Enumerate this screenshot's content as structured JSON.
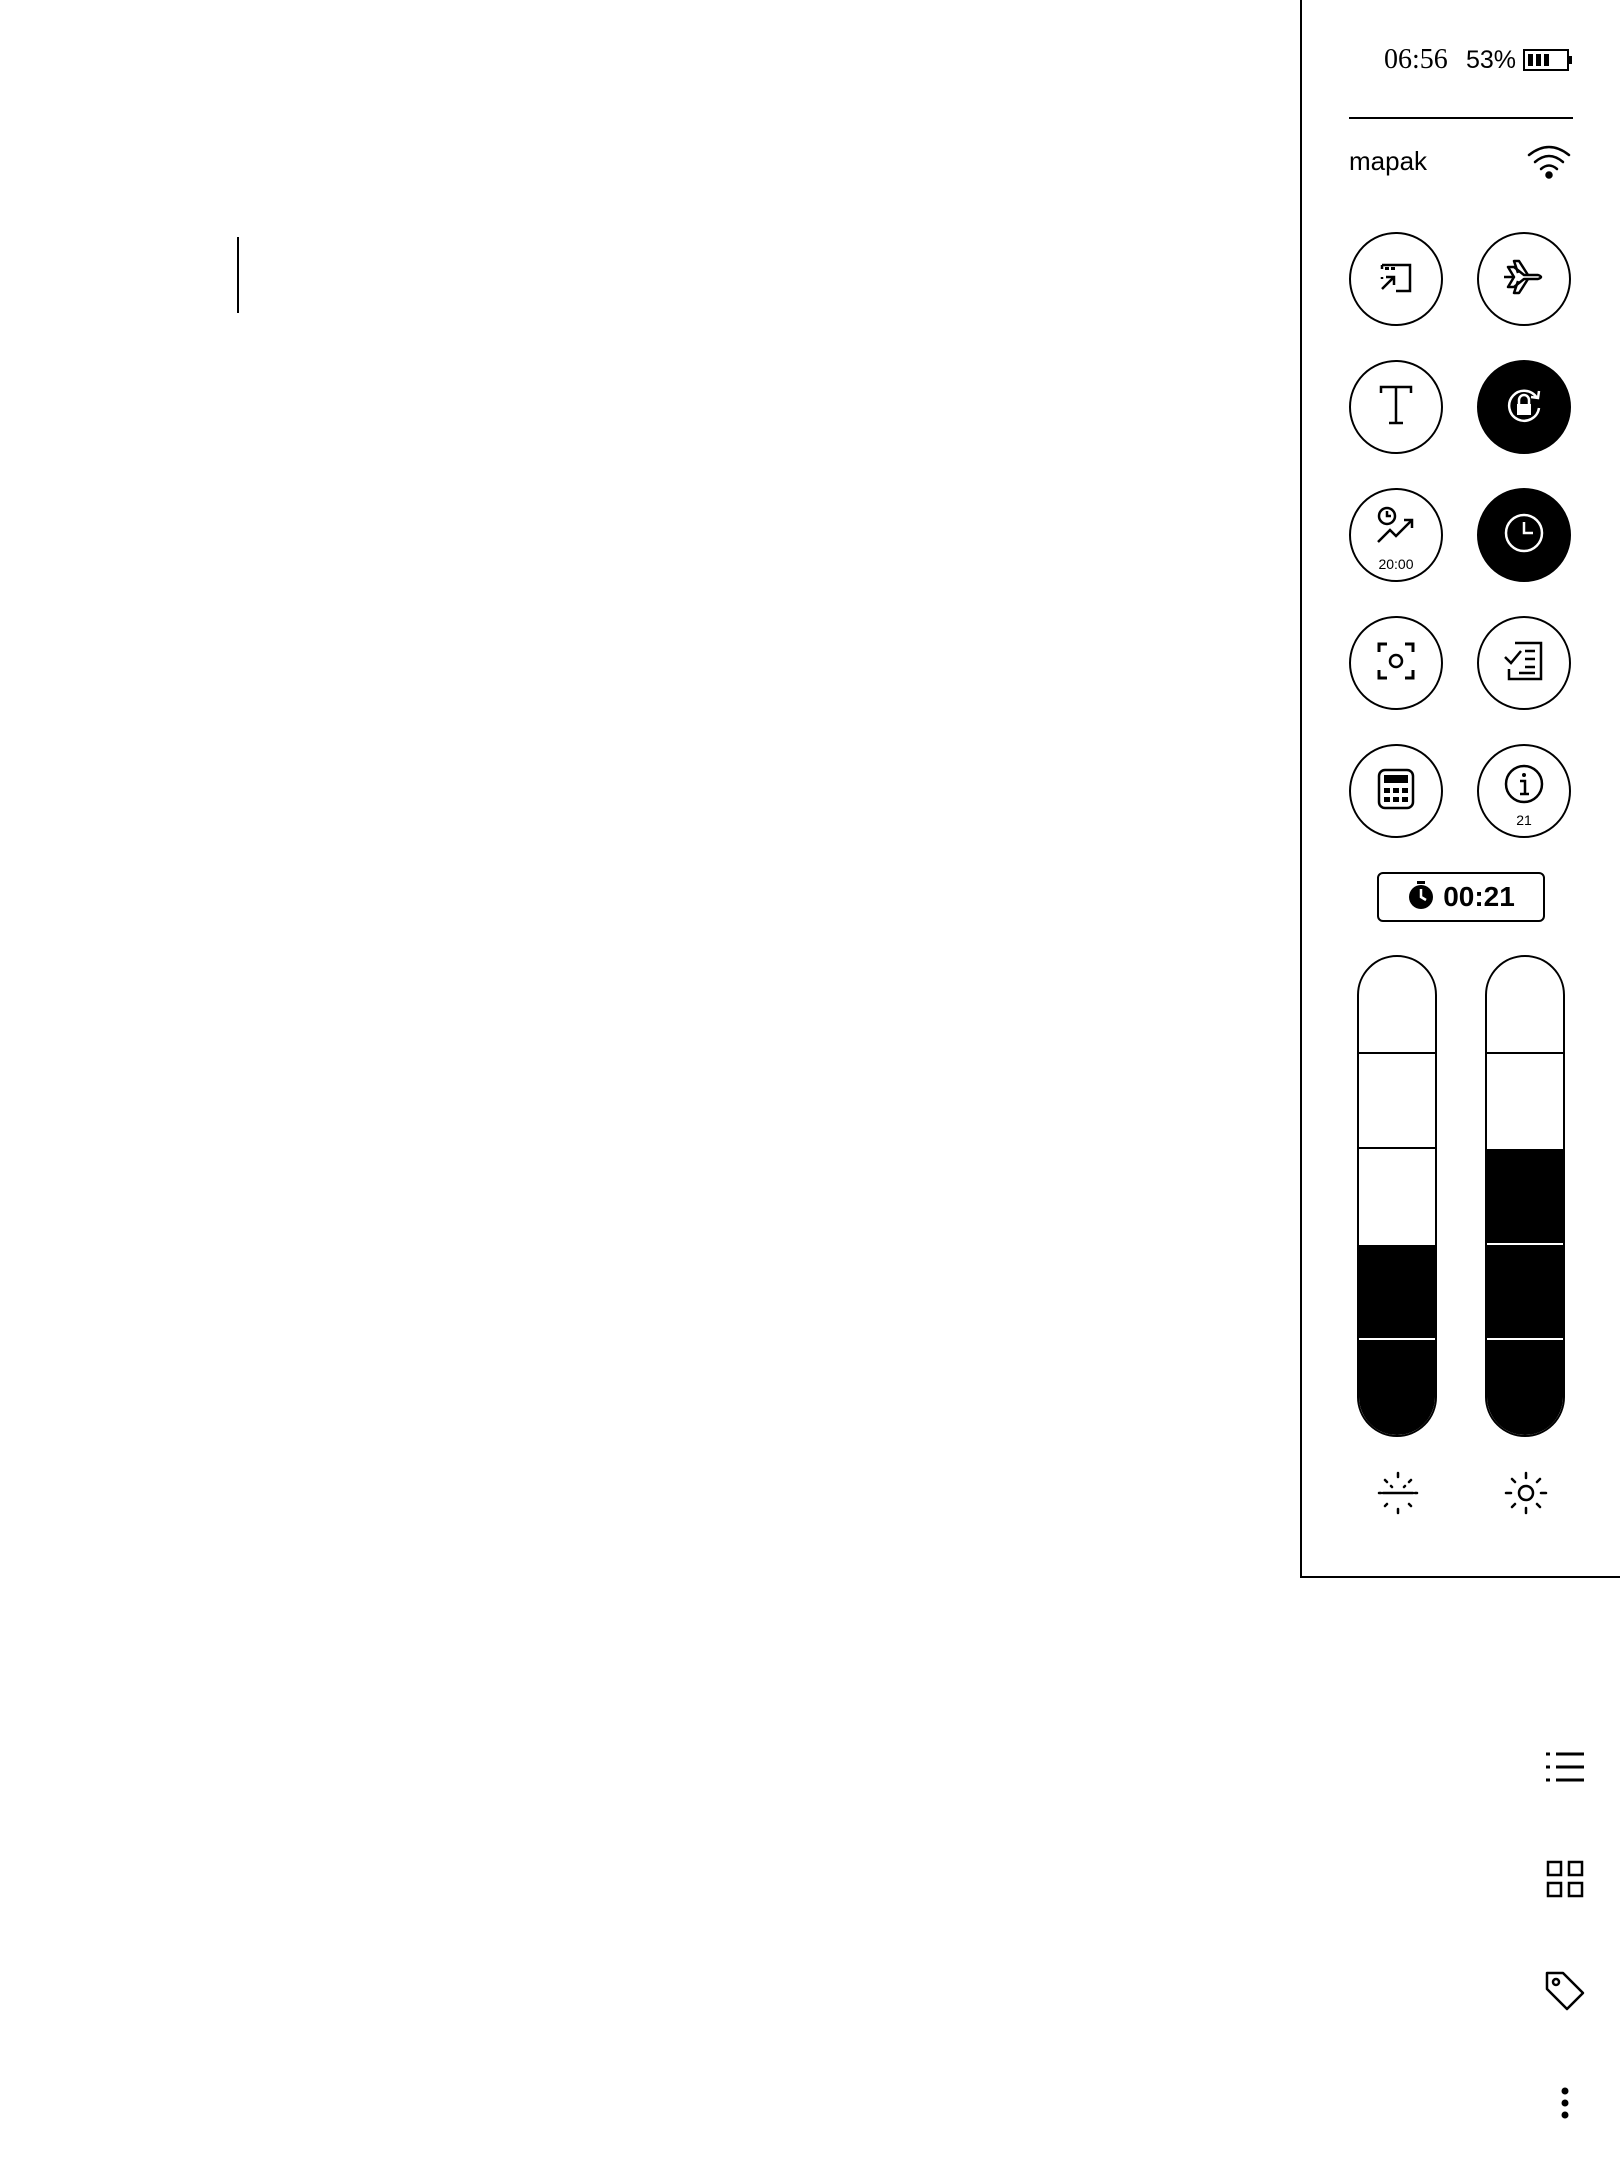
{
  "status": {
    "time": "06:56",
    "battery_percent": "53%"
  },
  "wifi": {
    "network_name": "mapak"
  },
  "quick_settings": [
    {
      "name": "screencast",
      "icon": "cast-icon",
      "active": false
    },
    {
      "name": "airplane-mode",
      "icon": "airplane-icon",
      "active": false
    },
    {
      "name": "font",
      "icon": "text-icon",
      "active": false
    },
    {
      "name": "rotation-lock",
      "icon": "rotation-lock-icon",
      "active": true
    },
    {
      "name": "scheduled-refresh",
      "icon": "schedule-trend-icon",
      "label": "20:00",
      "active": false
    },
    {
      "name": "clock",
      "icon": "clock-icon",
      "active": true
    },
    {
      "name": "screenshot",
      "icon": "screenshot-icon",
      "active": false
    },
    {
      "name": "tasks",
      "icon": "checklist-icon",
      "active": false
    },
    {
      "name": "calculator",
      "icon": "calculator-icon",
      "active": false
    },
    {
      "name": "info",
      "icon": "info-icon",
      "label": "21",
      "active": false
    }
  ],
  "timer": {
    "icon": "stopwatch-icon",
    "value": "00:21"
  },
  "sliders": [
    {
      "name": "warm-light",
      "icon": "dim-sun-icon",
      "level_steps": 2,
      "total_steps": 5
    },
    {
      "name": "brightness",
      "icon": "sun-icon",
      "level_steps": 3,
      "total_steps": 5
    }
  ],
  "rail": [
    {
      "name": "list-button",
      "icon": "list-icon"
    },
    {
      "name": "grid-button",
      "icon": "grid-icon"
    },
    {
      "name": "tag-button",
      "icon": "tag-icon"
    },
    {
      "name": "more-button",
      "icon": "more-vertical-icon"
    }
  ]
}
